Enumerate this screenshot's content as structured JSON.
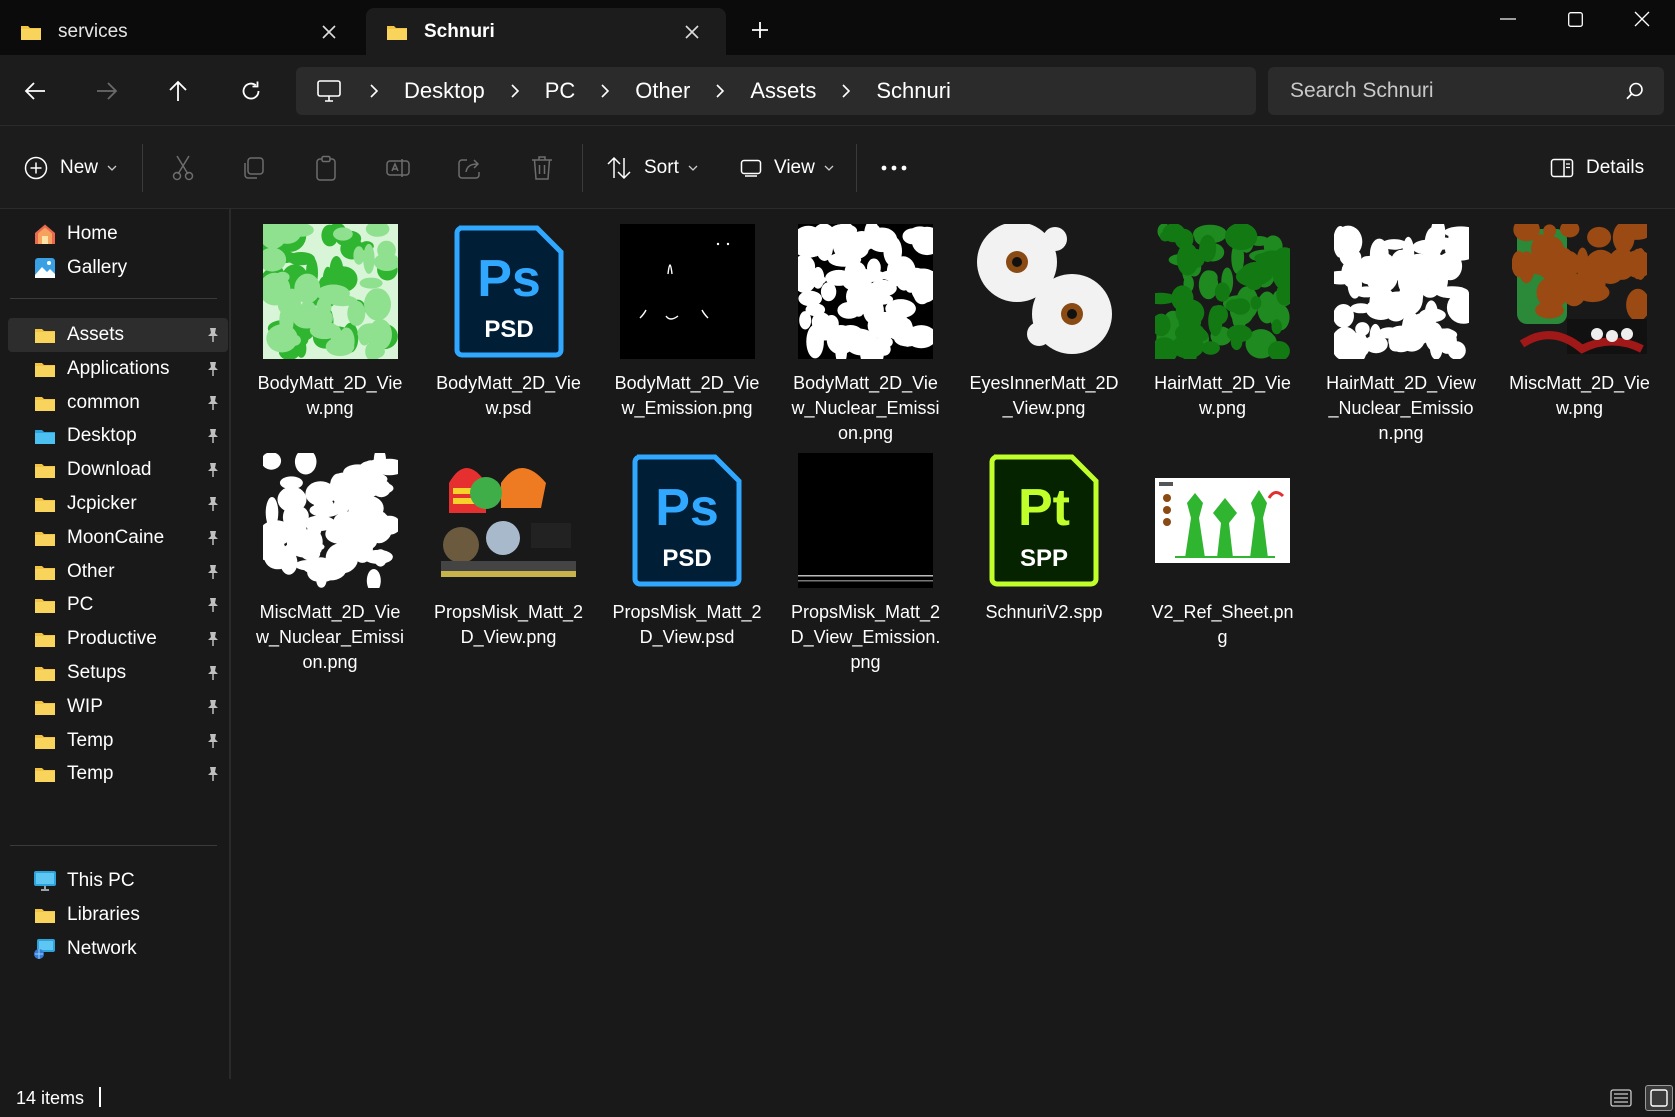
{
  "tabs": [
    {
      "label": "services",
      "active": false
    },
    {
      "label": "Schnuri",
      "active": true
    }
  ],
  "window_controls": [
    "minimize-icon",
    "maximize-icon",
    "close-icon"
  ],
  "breadcrumb": [
    "Desktop",
    "PC",
    "Other",
    "Assets",
    "Schnuri"
  ],
  "search": {
    "placeholder": "Search Schnuri"
  },
  "toolbar": {
    "new_label": "New",
    "sort_label": "Sort",
    "view_label": "View",
    "details_label": "Details"
  },
  "sidebar": {
    "top": [
      {
        "label": "Home",
        "icon": "home-icon"
      },
      {
        "label": "Gallery",
        "icon": "gallery-icon"
      }
    ],
    "pinned": [
      {
        "label": "Assets",
        "icon": "folder-icon",
        "selected": true
      },
      {
        "label": "Applications",
        "icon": "folder-icon"
      },
      {
        "label": "common",
        "icon": "folder-icon"
      },
      {
        "label": "Desktop",
        "icon": "desktop-folder-icon"
      },
      {
        "label": "Download",
        "icon": "folder-icon"
      },
      {
        "label": "Jcpicker",
        "icon": "folder-icon"
      },
      {
        "label": "MoonCaine",
        "icon": "folder-icon"
      },
      {
        "label": "Other",
        "icon": "folder-icon"
      },
      {
        "label": "PC",
        "icon": "folder-icon"
      },
      {
        "label": "Productive",
        "icon": "folder-icon"
      },
      {
        "label": "Setups",
        "icon": "folder-icon"
      },
      {
        "label": "WIP",
        "icon": "folder-icon"
      },
      {
        "label": "Temp",
        "icon": "folder-icon"
      },
      {
        "label": "Temp",
        "icon": "folder-icon"
      }
    ],
    "bottom": [
      {
        "label": "This PC",
        "icon": "this-pc-icon"
      },
      {
        "label": "Libraries",
        "icon": "libraries-icon"
      },
      {
        "label": "Network",
        "icon": "network-icon"
      }
    ]
  },
  "files": [
    {
      "name": "BodyMatt_2D_View.png",
      "thumb": "green-uv-texture"
    },
    {
      "name": "BodyMatt_2D_View.psd",
      "thumb": "photoshop-psd"
    },
    {
      "name": "BodyMatt_2D_View_Emission.png",
      "thumb": "black-emission"
    },
    {
      "name": "BodyMatt_2D_View_Nuclear_Emission.png",
      "thumb": "white-uv-mask"
    },
    {
      "name": "EyesInnerMatt_2D_View.png",
      "thumb": "eyes-texture"
    },
    {
      "name": "HairMatt_2D_View.png",
      "thumb": "green-hair-texture"
    },
    {
      "name": "HairMatt_2D_View_Nuclear_Emission.png",
      "thumb": "white-hair-mask"
    },
    {
      "name": "MiscMatt_2D_View.png",
      "thumb": "misc-texture"
    },
    {
      "name": "MiscMatt_2D_View_Nuclear_Emission.png",
      "thumb": "white-misc-mask"
    },
    {
      "name": "PropsMisk_Matt_2D_View.png",
      "thumb": "props-texture"
    },
    {
      "name": "PropsMisk_Matt_2D_View.psd",
      "thumb": "photoshop-psd"
    },
    {
      "name": "PropsMisk_Matt_2D_View_Emission.png",
      "thumb": "black-props-emission"
    },
    {
      "name": "SchnuriV2.spp",
      "thumb": "substance-painter-spp"
    },
    {
      "name": "V2_Ref_Sheet.png",
      "thumb": "ref-sheet"
    }
  ],
  "psd_badge": {
    "top": "Ps",
    "bottom": "PSD"
  },
  "spp_badge": {
    "top": "Pt",
    "bottom": "SPP"
  },
  "colors": {
    "background": "#191919",
    "chrome": "#1c1c1c",
    "titlebar": "#0b0b0b",
    "folder": "#f3c441",
    "photoshop_blue": "#31a8ff",
    "photoshop_bg": "#001e36",
    "painter_green": "#c1ff2b",
    "painter_bg": "#062300",
    "uv_green": "#2fb52f"
  },
  "status": {
    "item_count": "14 items"
  }
}
